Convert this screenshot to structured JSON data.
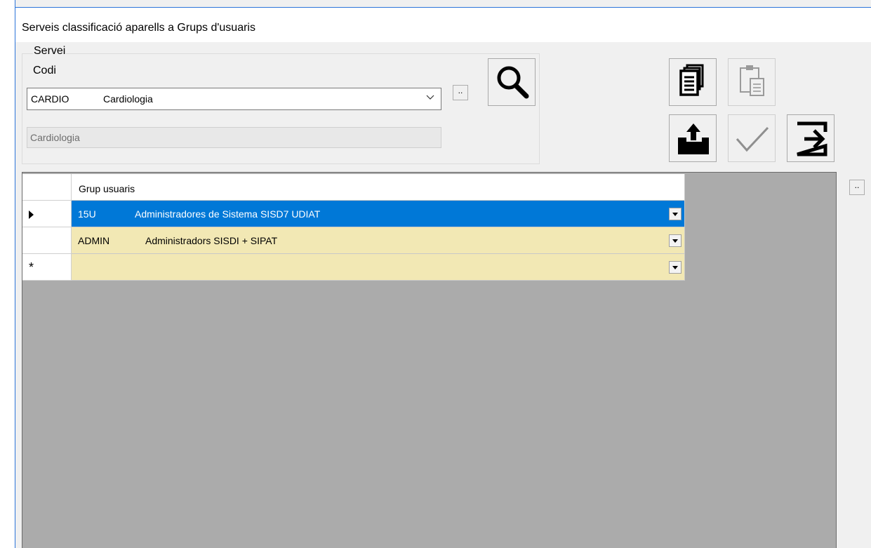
{
  "window": {
    "title": "Serveis classificació aparells a Grups d'usuaris"
  },
  "servei": {
    "group_label": "Servei",
    "codi_label": "Codi",
    "combo": {
      "code": "CARDIO",
      "name": "Cardiologia"
    },
    "browse_label": "..",
    "description": "Cardiologia"
  },
  "toolbar": {
    "search": "search-icon",
    "copy": "copy-icon",
    "paste": "paste-icon",
    "export": "export-icon",
    "accept": "check-icon",
    "exit": "exit-icon"
  },
  "grid": {
    "column_header": "Grup usuaris",
    "new_row_marker": "*",
    "current_row_marker": "▶",
    "rows": [
      {
        "code": "15U",
        "name": "Administradores de Sistema SISD7 UDIAT"
      },
      {
        "code": "ADMIN",
        "name": "Administradors SISDI + SIPAT"
      }
    ],
    "side_button_label": ".."
  }
}
